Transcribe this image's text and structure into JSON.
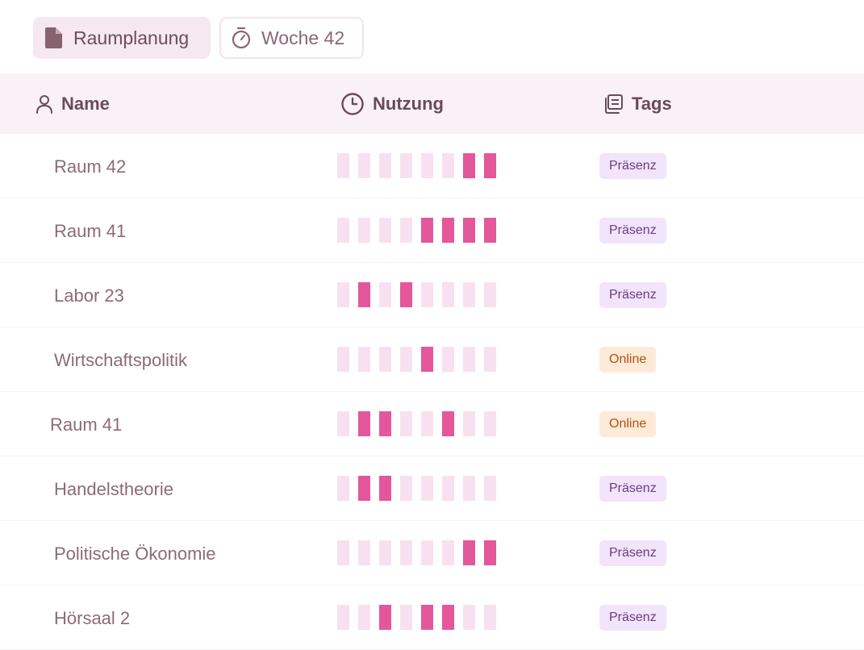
{
  "toolbar": {
    "document_chip": {
      "label": "Raumplanung",
      "icon": "document-icon"
    },
    "week_chip": {
      "label": "Woche 42",
      "icon": "stopwatch-icon"
    }
  },
  "table": {
    "columns": [
      {
        "label": "Name",
        "icon": "person-icon"
      },
      {
        "label": "Nutzung",
        "icon": "clock-icon"
      },
      {
        "label": "Tags",
        "icon": "tags-icon"
      }
    ],
    "rows": [
      {
        "name": "Raum 42",
        "usage": [
          0,
          0,
          0,
          0,
          0,
          0,
          1,
          1
        ],
        "tag": "Präsenz",
        "tag_type": "praesenz"
      },
      {
        "name": "Raum 41",
        "usage": [
          0,
          0,
          0,
          0,
          1,
          1,
          1,
          1
        ],
        "tag": "Präsenz",
        "tag_type": "praesenz"
      },
      {
        "name": "Labor 23",
        "usage": [
          0,
          1,
          0,
          1,
          0,
          0,
          0,
          0
        ],
        "tag": "Präsenz",
        "tag_type": "praesenz"
      },
      {
        "name": "Wirtschaftspolitik",
        "usage": [
          0,
          0,
          0,
          0,
          1,
          0,
          0,
          0
        ],
        "tag": "Online",
        "tag_type": "online"
      },
      {
        "name": "Raum 41",
        "usage": [
          0,
          1,
          1,
          0,
          0,
          1,
          0,
          0
        ],
        "tag": "Online",
        "tag_type": "online"
      },
      {
        "name": "Handelstheorie",
        "usage": [
          0,
          1,
          1,
          0,
          0,
          0,
          0,
          0
        ],
        "tag": "Präsenz",
        "tag_type": "praesenz"
      },
      {
        "name": "Politische Ökonomie",
        "usage": [
          0,
          0,
          0,
          0,
          0,
          0,
          1,
          1
        ],
        "tag": "Präsenz",
        "tag_type": "praesenz"
      },
      {
        "name": "Hörsaal 2",
        "usage": [
          0,
          0,
          1,
          0,
          1,
          1,
          0,
          0
        ],
        "tag": "Präsenz",
        "tag_type": "praesenz"
      }
    ]
  },
  "colors": {
    "usage_active": "#e4579a",
    "usage_inactive": "#f7e1f1",
    "tag_praesenz_bg": "#f1e4fb",
    "tag_online_bg": "#feead8"
  }
}
